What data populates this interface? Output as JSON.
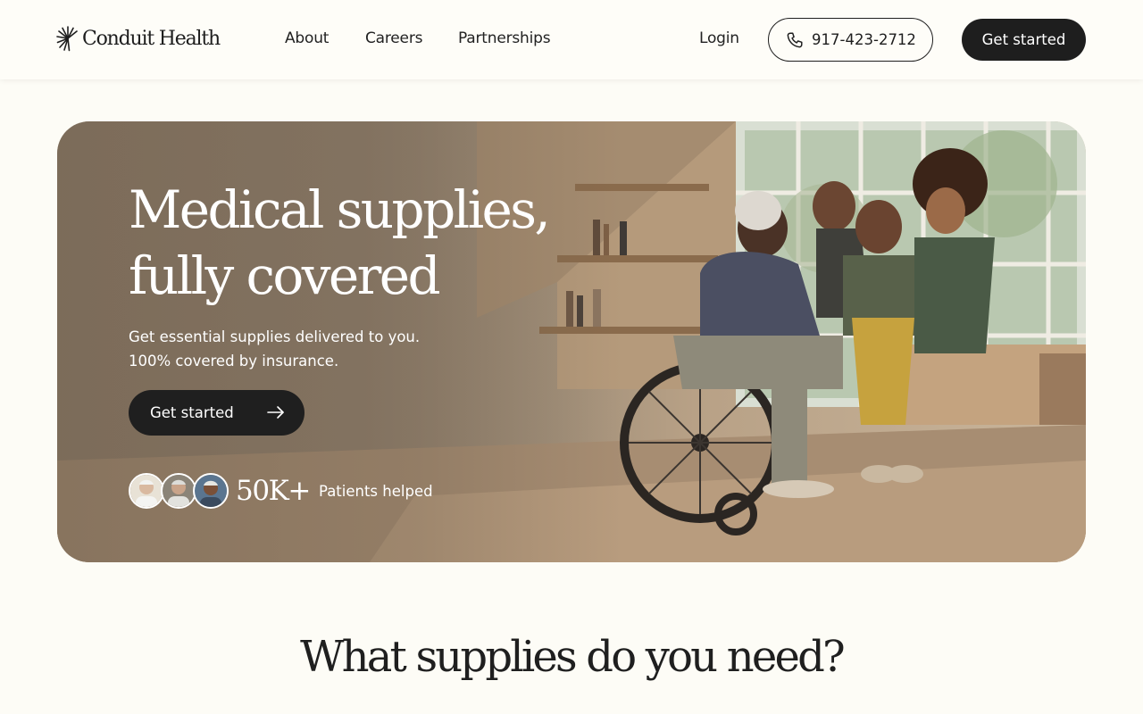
{
  "brand": {
    "name": "Conduit Health"
  },
  "nav": {
    "links": [
      "About",
      "Careers",
      "Partnerships"
    ],
    "login": "Login",
    "phone": "917-423-2712",
    "cta": "Get started"
  },
  "hero": {
    "title_line1": "Medical supplies,",
    "title_line2": "fully covered",
    "subtitle_line1": "Get essential supplies delivered to you.",
    "subtitle_line2": "100% covered by insurance.",
    "cta": "Get started",
    "stat_value": "50K+",
    "stat_label": "Patients helped"
  },
  "section": {
    "title": "What supplies do you need?"
  },
  "colors": {
    "background": "#fdfcf6",
    "button_dark": "#1e1e1e",
    "text": "#1d1d1d"
  }
}
